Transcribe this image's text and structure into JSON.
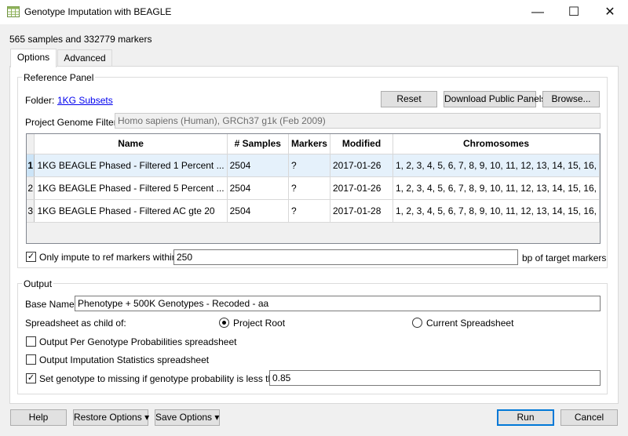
{
  "window": {
    "title": "Genotype Imputation with BEAGLE",
    "minimize_glyph": "—",
    "maximize_glyph": "☐",
    "close_glyph": "✕"
  },
  "info": "565 samples and 332779 markers",
  "tabs": [
    {
      "label": "Options",
      "active": true
    },
    {
      "label": "Advanced",
      "active": false
    }
  ],
  "reference_panel": {
    "legend": "Reference Panel",
    "folder_label": "Folder:",
    "folder_link": "1KG Subsets",
    "reset_label": "Reset",
    "download_label": "Download Public Panels",
    "browse_label": "Browse...",
    "genome_filter_label": "Project Genome Filter:",
    "genome_filter_value": "Homo sapiens (Human), GRCh37 g1k (Feb 2009)",
    "table": {
      "columns": [
        "Name",
        "# Samples",
        "Markers",
        "Modified",
        "Chromosomes"
      ],
      "rows": [
        {
          "num": "1",
          "name": "1KG BEAGLE Phased - Filtered 1 Percent ...",
          "samples": "2504",
          "markers": "?",
          "modified": "2017-01-26",
          "chromosomes": "1, 2, 3, 4, 5, 6, 7, 8, 9, 10, 11, 12, 13, 14, 15, 16,",
          "selected": true
        },
        {
          "num": "2",
          "name": "1KG BEAGLE Phased - Filtered 5 Percent ...",
          "samples": "2504",
          "markers": "?",
          "modified": "2017-01-26",
          "chromosomes": "1, 2, 3, 4, 5, 6, 7, 8, 9, 10, 11, 12, 13, 14, 15, 16,",
          "selected": false
        },
        {
          "num": "3",
          "name": "1KG BEAGLE Phased - Filtered AC gte 20",
          "samples": "2504",
          "markers": "?",
          "modified": "2017-01-28",
          "chromosomes": "1, 2, 3, 4, 5, 6, 7, 8, 9, 10, 11, 12, 13, 14, 15, 16,",
          "selected": false
        }
      ]
    },
    "only_impute_label": "Only impute to ref markers within",
    "only_impute_checked": true,
    "only_impute_value": "250",
    "bp_label": "bp of target markers"
  },
  "output": {
    "legend": "Output",
    "base_name_label": "Base Name:",
    "base_name_value": "Phenotype + 500K Genotypes - Recoded - aa",
    "spreadsheet_child_label": "Spreadsheet as child of:",
    "radio_project_root": "Project Root",
    "radio_current_spreadsheet": "Current Spreadsheet",
    "selected_parent": "Project Root",
    "per_genotype_label": "Output Per Genotype Probabilities spreadsheet",
    "per_genotype_checked": false,
    "stats_label": "Output Imputation Statistics spreadsheet",
    "stats_checked": false,
    "set_missing_label": "Set genotype to missing if genotype probability is less than",
    "set_missing_checked": true,
    "set_missing_value": "0.85"
  },
  "footer": {
    "help_label": "Help",
    "restore_label": "Restore Options",
    "save_label": "Save Options",
    "run_label": "Run",
    "cancel_label": "Cancel"
  }
}
